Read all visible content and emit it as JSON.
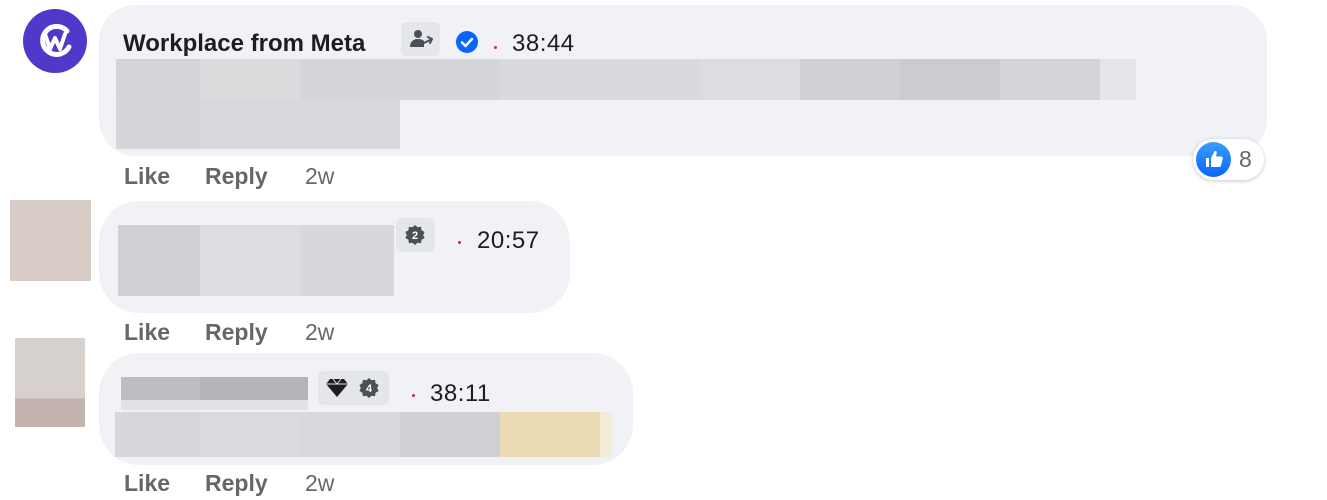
{
  "comments": [
    {
      "author": "Workplace from Meta",
      "verified": true,
      "author_badge_icon": "user-share-icon",
      "timestamp": "38:44",
      "reaction": {
        "icon": "like-icon",
        "count": "8",
        "color": "#0866ff"
      },
      "actions": {
        "like": "Like",
        "reply": "Reply",
        "age": "2w"
      }
    },
    {
      "badge": {
        "icon": "level-badge-icon",
        "level": "2"
      },
      "timestamp": "20:57",
      "actions": {
        "like": "Like",
        "reply": "Reply",
        "age": "2w"
      }
    },
    {
      "badge": {
        "icon": "diamond-icon",
        "level": "4"
      },
      "timestamp": "38:11",
      "actions": {
        "like": "Like",
        "reply": "Reply",
        "age": "2w"
      }
    }
  ],
  "colors": {
    "bubble": "#f0f2f5",
    "logo": "#5038c8",
    "verified": "#0866ff",
    "separator_dot": "#e41e3f",
    "action_text": "#65676b"
  }
}
